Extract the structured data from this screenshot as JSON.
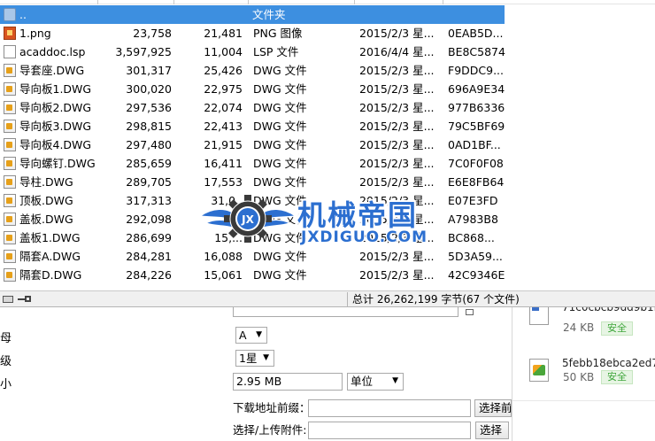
{
  "filelist": {
    "parent": {
      "name": "..",
      "type": "文件夹"
    },
    "files": [
      {
        "name": "1.png",
        "size": "23,758",
        "packed": "21,481",
        "type": "PNG 图像",
        "modified": "2015/2/3 星...",
        "crc": "0EAB5D...",
        "icon": "png-icon"
      },
      {
        "name": "acaddoc.lsp",
        "size": "3,597,925",
        "packed": "11,004",
        "type": "LSP 文件",
        "modified": "2016/4/4 星...",
        "crc": "BE8C5874",
        "icon": "lsp-file-icon"
      },
      {
        "name": "导套座.DWG",
        "size": "301,317",
        "packed": "25,426",
        "type": "DWG 文件",
        "modified": "2015/2/3 星...",
        "crc": "F9DDC9...",
        "icon": "dwg-file-icon"
      },
      {
        "name": "导向板1.DWG",
        "size": "300,020",
        "packed": "22,975",
        "type": "DWG 文件",
        "modified": "2015/2/3 星...",
        "crc": "696A9E34",
        "icon": "dwg-file-icon"
      },
      {
        "name": "导向板2.DWG",
        "size": "297,536",
        "packed": "22,074",
        "type": "DWG 文件",
        "modified": "2015/2/3 星...",
        "crc": "977B6336",
        "icon": "dwg-file-icon"
      },
      {
        "name": "导向板3.DWG",
        "size": "298,815",
        "packed": "22,413",
        "type": "DWG 文件",
        "modified": "2015/2/3 星...",
        "crc": "79C5BF69",
        "icon": "dwg-file-icon"
      },
      {
        "name": "导向板4.DWG",
        "size": "297,480",
        "packed": "21,915",
        "type": "DWG 文件",
        "modified": "2015/2/3 星...",
        "crc": "0AD1BF...",
        "icon": "dwg-file-icon"
      },
      {
        "name": "导向螺钉.DWG",
        "size": "285,659",
        "packed": "16,411",
        "type": "DWG 文件",
        "modified": "2015/2/3 星...",
        "crc": "7C0F0F08",
        "icon": "dwg-file-icon"
      },
      {
        "name": "导柱.DWG",
        "size": "289,705",
        "packed": "17,553",
        "type": "DWG 文件",
        "modified": "2015/2/3 星...",
        "crc": "E6E8FB64",
        "icon": "dwg-file-icon"
      },
      {
        "name": "顶板.DWG",
        "size": "317,313",
        "packed": "31,0..",
        "type": "DWG 文件",
        "modified": "2015/2/3 星...",
        "crc": "E07E3FD",
        "icon": "dwg-file-icon"
      },
      {
        "name": "盖板.DWG",
        "size": "292,098",
        "packed": "",
        "type": "DWG 文件",
        "modified": "2015/2/3 星...",
        "crc": "A7983B8",
        "icon": "dwg-file-icon"
      },
      {
        "name": "盖板1.DWG",
        "size": "286,699",
        "packed": "15,...",
        "type": "DWG 文件",
        "modified": "2015/2/3 星...",
        "crc": "BC868...",
        "icon": "dwg-file-icon"
      },
      {
        "name": "隔套A.DWG",
        "size": "284,281",
        "packed": "16,088",
        "type": "DWG 文件",
        "modified": "2015/2/3 星...",
        "crc": "5D3A59...",
        "icon": "dwg-file-icon"
      },
      {
        "name": "隔套D.DWG",
        "size": "284,226",
        "packed": "15,061",
        "type": "DWG 文件",
        "modified": "2015/2/3 星...",
        "crc": "42C9346E",
        "icon": "dwg-file-icon"
      }
    ]
  },
  "watermark": {
    "cn": "机械帝国",
    "en": "JXDIGUO.COM",
    "emblem": "JX"
  },
  "statusbar": {
    "summary": "总计 26,262,199 字节(67 个文件)"
  },
  "form": {
    "row1": {
      "label": "母",
      "value": "A"
    },
    "row2": {
      "label": "级",
      "value": "1星"
    },
    "row3": {
      "label": "小",
      "value": "2.95 MB",
      "unit": "单位"
    },
    "prefix": {
      "label": "下载地址前缀：",
      "value": "",
      "button": "选择前"
    },
    "upload": {
      "label": "选择/上传附件:",
      "value": "",
      "button": "选择"
    }
  },
  "downloads": {
    "items": [
      {
        "name": "71c0cbcb9dd9b1b",
        "size": "24 KB",
        "status": "安全"
      },
      {
        "name": "5febb18ebca2ed7",
        "size": "50 KB",
        "status": "安全"
      }
    ]
  },
  "colors": {
    "selection": "#3d8fe0",
    "logo": "#2c6fd0",
    "safe": "#3ea63a"
  }
}
